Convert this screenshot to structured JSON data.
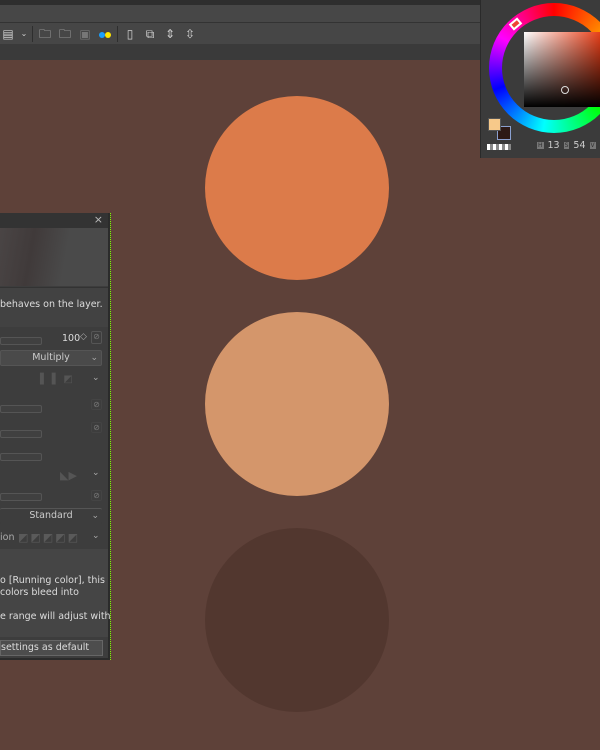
{
  "toolbar": {
    "icons": [
      "layout-icon",
      "chevron-down-icon",
      "open-folder-icon",
      "open-folder-2-icon",
      "import-image-icon",
      "color-set-icon",
      "page-icon",
      "duplicate-icon",
      "expand-icon",
      "contract-icon"
    ]
  },
  "canvas": {
    "circles": [
      {
        "name": "orange-circle",
        "color": "#dc7b4a"
      },
      {
        "name": "peach-circle",
        "color": "#d4966b"
      },
      {
        "name": "dark-brown-circle",
        "color": "#52372f"
      }
    ],
    "background": "#5e4139"
  },
  "dialog": {
    "close": "×",
    "description": "behaves on the layer.",
    "opacity_value": "100",
    "blend_mode": "Multiply",
    "standard_option": "Standard",
    "partial_label": "ion",
    "help_line1": "o [Running color], this",
    "help_line2": "colors bleed into",
    "help_line3": "e range will adjust with",
    "default_button": "settings as default"
  },
  "color_panel": {
    "h_label": "H",
    "h_value": "13",
    "s_label": "S",
    "s_value": "54",
    "v_label": "V",
    "main_color": "#f7c98a",
    "sub_color": "#2d1a16"
  }
}
